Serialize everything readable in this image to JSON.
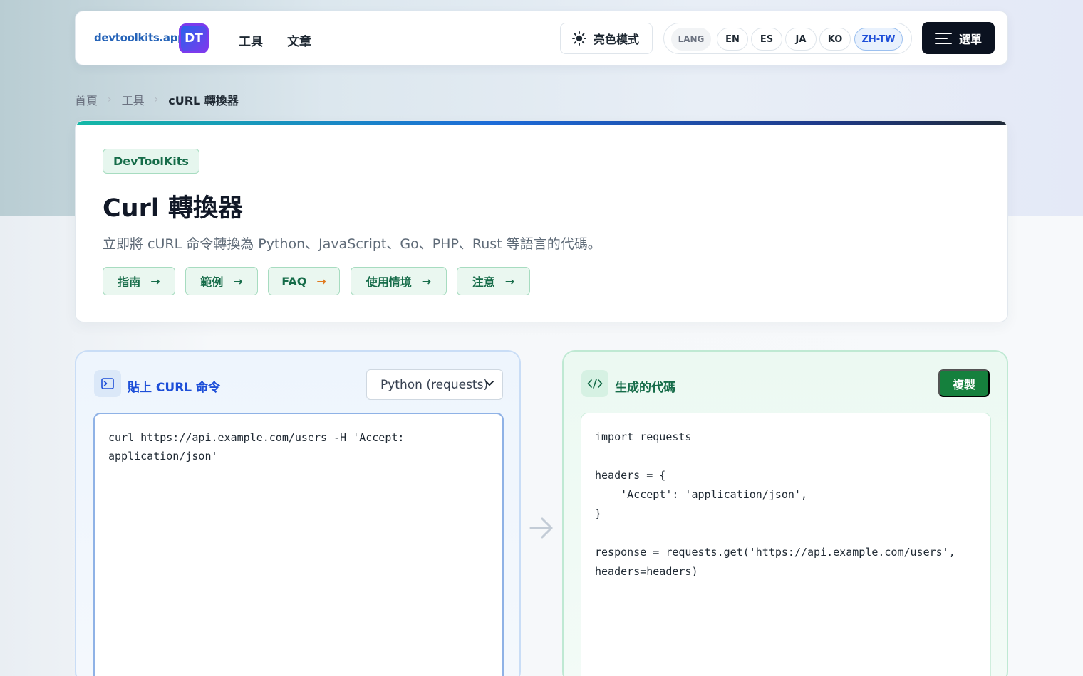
{
  "header": {
    "logo_text": "devtoolkits.app",
    "logo_mark": "DT",
    "nav": [
      "工具",
      "文章"
    ],
    "theme_label": "亮色模式",
    "lang_label": "LANG",
    "languages": [
      "EN",
      "ES",
      "JA",
      "KO",
      "ZH-TW"
    ],
    "active_language": "ZH-TW",
    "menu_label": "選單"
  },
  "breadcrumb": {
    "items": [
      "首頁",
      "工具"
    ],
    "current": "cURL 轉換器"
  },
  "hero": {
    "badge": "DevToolKits",
    "title": "Curl 轉換器",
    "subtitle": "立即將 cURL 命令轉換為 Python、JavaScript、Go、PHP、Rust 等語言的代碼。",
    "chips": [
      "指南",
      "範例",
      "FAQ",
      "使用情境",
      "注意"
    ]
  },
  "input_panel": {
    "title": "貼上 CURL 命令",
    "selected_language": "Python (requests)",
    "value": "curl https://api.example.com/users -H 'Accept:\napplication/json'"
  },
  "output_panel": {
    "title": "生成的代碼",
    "copy_label": "複製",
    "code": "import requests\n\nheaders = {\n    'Accept': 'application/json',\n}\n\nresponse = requests.get('https://api.example.com/users',\nheaders=headers)"
  },
  "colors": {
    "brand_blue": "#1d4ed8",
    "brand_green": "#15803d",
    "menu_dark": "#0b1220"
  }
}
